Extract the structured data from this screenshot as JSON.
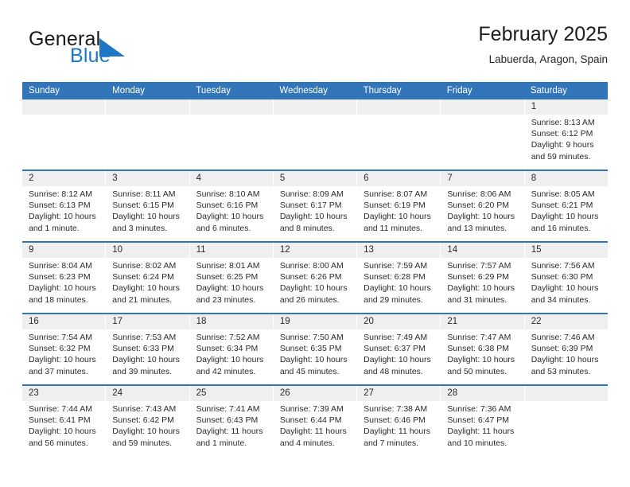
{
  "brand": {
    "name_part1": "General",
    "name_part2": "Blue",
    "flag_color": "#1f76c2"
  },
  "header": {
    "title": "February 2025",
    "location": "Labuerda, Aragon, Spain"
  },
  "theme": {
    "header_blue": "#3275b9",
    "daynum_band": "#efefef",
    "text": "#2b2b2b"
  },
  "weekdays": [
    "Sunday",
    "Monday",
    "Tuesday",
    "Wednesday",
    "Thursday",
    "Friday",
    "Saturday"
  ],
  "weeks": [
    [
      {
        "day": "",
        "empty": true
      },
      {
        "day": "",
        "empty": true
      },
      {
        "day": "",
        "empty": true
      },
      {
        "day": "",
        "empty": true
      },
      {
        "day": "",
        "empty": true
      },
      {
        "day": "",
        "empty": true
      },
      {
        "day": "1",
        "sunrise": "Sunrise: 8:13 AM",
        "sunset": "Sunset: 6:12 PM",
        "daylight1": "Daylight: 9 hours",
        "daylight2": "and 59 minutes."
      }
    ],
    [
      {
        "day": "2",
        "sunrise": "Sunrise: 8:12 AM",
        "sunset": "Sunset: 6:13 PM",
        "daylight1": "Daylight: 10 hours",
        "daylight2": "and 1 minute."
      },
      {
        "day": "3",
        "sunrise": "Sunrise: 8:11 AM",
        "sunset": "Sunset: 6:15 PM",
        "daylight1": "Daylight: 10 hours",
        "daylight2": "and 3 minutes."
      },
      {
        "day": "4",
        "sunrise": "Sunrise: 8:10 AM",
        "sunset": "Sunset: 6:16 PM",
        "daylight1": "Daylight: 10 hours",
        "daylight2": "and 6 minutes."
      },
      {
        "day": "5",
        "sunrise": "Sunrise: 8:09 AM",
        "sunset": "Sunset: 6:17 PM",
        "daylight1": "Daylight: 10 hours",
        "daylight2": "and 8 minutes."
      },
      {
        "day": "6",
        "sunrise": "Sunrise: 8:07 AM",
        "sunset": "Sunset: 6:19 PM",
        "daylight1": "Daylight: 10 hours",
        "daylight2": "and 11 minutes."
      },
      {
        "day": "7",
        "sunrise": "Sunrise: 8:06 AM",
        "sunset": "Sunset: 6:20 PM",
        "daylight1": "Daylight: 10 hours",
        "daylight2": "and 13 minutes."
      },
      {
        "day": "8",
        "sunrise": "Sunrise: 8:05 AM",
        "sunset": "Sunset: 6:21 PM",
        "daylight1": "Daylight: 10 hours",
        "daylight2": "and 16 minutes."
      }
    ],
    [
      {
        "day": "9",
        "sunrise": "Sunrise: 8:04 AM",
        "sunset": "Sunset: 6:23 PM",
        "daylight1": "Daylight: 10 hours",
        "daylight2": "and 18 minutes."
      },
      {
        "day": "10",
        "sunrise": "Sunrise: 8:02 AM",
        "sunset": "Sunset: 6:24 PM",
        "daylight1": "Daylight: 10 hours",
        "daylight2": "and 21 minutes."
      },
      {
        "day": "11",
        "sunrise": "Sunrise: 8:01 AM",
        "sunset": "Sunset: 6:25 PM",
        "daylight1": "Daylight: 10 hours",
        "daylight2": "and 23 minutes."
      },
      {
        "day": "12",
        "sunrise": "Sunrise: 8:00 AM",
        "sunset": "Sunset: 6:26 PM",
        "daylight1": "Daylight: 10 hours",
        "daylight2": "and 26 minutes."
      },
      {
        "day": "13",
        "sunrise": "Sunrise: 7:59 AM",
        "sunset": "Sunset: 6:28 PM",
        "daylight1": "Daylight: 10 hours",
        "daylight2": "and 29 minutes."
      },
      {
        "day": "14",
        "sunrise": "Sunrise: 7:57 AM",
        "sunset": "Sunset: 6:29 PM",
        "daylight1": "Daylight: 10 hours",
        "daylight2": "and 31 minutes."
      },
      {
        "day": "15",
        "sunrise": "Sunrise: 7:56 AM",
        "sunset": "Sunset: 6:30 PM",
        "daylight1": "Daylight: 10 hours",
        "daylight2": "and 34 minutes."
      }
    ],
    [
      {
        "day": "16",
        "sunrise": "Sunrise: 7:54 AM",
        "sunset": "Sunset: 6:32 PM",
        "daylight1": "Daylight: 10 hours",
        "daylight2": "and 37 minutes."
      },
      {
        "day": "17",
        "sunrise": "Sunrise: 7:53 AM",
        "sunset": "Sunset: 6:33 PM",
        "daylight1": "Daylight: 10 hours",
        "daylight2": "and 39 minutes."
      },
      {
        "day": "18",
        "sunrise": "Sunrise: 7:52 AM",
        "sunset": "Sunset: 6:34 PM",
        "daylight1": "Daylight: 10 hours",
        "daylight2": "and 42 minutes."
      },
      {
        "day": "19",
        "sunrise": "Sunrise: 7:50 AM",
        "sunset": "Sunset: 6:35 PM",
        "daylight1": "Daylight: 10 hours",
        "daylight2": "and 45 minutes."
      },
      {
        "day": "20",
        "sunrise": "Sunrise: 7:49 AM",
        "sunset": "Sunset: 6:37 PM",
        "daylight1": "Daylight: 10 hours",
        "daylight2": "and 48 minutes."
      },
      {
        "day": "21",
        "sunrise": "Sunrise: 7:47 AM",
        "sunset": "Sunset: 6:38 PM",
        "daylight1": "Daylight: 10 hours",
        "daylight2": "and 50 minutes."
      },
      {
        "day": "22",
        "sunrise": "Sunrise: 7:46 AM",
        "sunset": "Sunset: 6:39 PM",
        "daylight1": "Daylight: 10 hours",
        "daylight2": "and 53 minutes."
      }
    ],
    [
      {
        "day": "23",
        "sunrise": "Sunrise: 7:44 AM",
        "sunset": "Sunset: 6:41 PM",
        "daylight1": "Daylight: 10 hours",
        "daylight2": "and 56 minutes."
      },
      {
        "day": "24",
        "sunrise": "Sunrise: 7:43 AM",
        "sunset": "Sunset: 6:42 PM",
        "daylight1": "Daylight: 10 hours",
        "daylight2": "and 59 minutes."
      },
      {
        "day": "25",
        "sunrise": "Sunrise: 7:41 AM",
        "sunset": "Sunset: 6:43 PM",
        "daylight1": "Daylight: 11 hours",
        "daylight2": "and 1 minute."
      },
      {
        "day": "26",
        "sunrise": "Sunrise: 7:39 AM",
        "sunset": "Sunset: 6:44 PM",
        "daylight1": "Daylight: 11 hours",
        "daylight2": "and 4 minutes."
      },
      {
        "day": "27",
        "sunrise": "Sunrise: 7:38 AM",
        "sunset": "Sunset: 6:46 PM",
        "daylight1": "Daylight: 11 hours",
        "daylight2": "and 7 minutes."
      },
      {
        "day": "28",
        "sunrise": "Sunrise: 7:36 AM",
        "sunset": "Sunset: 6:47 PM",
        "daylight1": "Daylight: 11 hours",
        "daylight2": "and 10 minutes."
      },
      {
        "day": "",
        "empty": true
      }
    ]
  ]
}
